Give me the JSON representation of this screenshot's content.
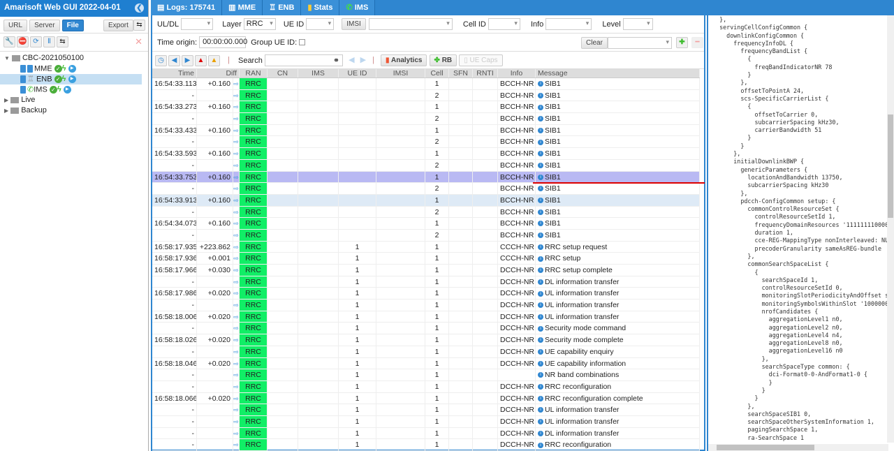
{
  "app": {
    "title": "Amarisoft Web GUI 2022-04-01"
  },
  "left": {
    "buttons": {
      "url": "URL",
      "server": "Server",
      "file": "File",
      "export": "Export"
    },
    "tree": [
      {
        "label": "CBC-2021050100"
      },
      {
        "label": "MME"
      },
      {
        "label": "ENB",
        "selected": true
      },
      {
        "label": "IMS"
      },
      {
        "label": "Live"
      },
      {
        "label": "Backup"
      }
    ]
  },
  "tabs": [
    {
      "label": "Logs: 175741",
      "icon": "document-icon"
    },
    {
      "label": "MME",
      "icon": "database-icon"
    },
    {
      "label": "ENB",
      "icon": "antenna-icon"
    },
    {
      "label": "Stats",
      "icon": "bar-chart-icon"
    },
    {
      "label": "IMS",
      "icon": "phone-icon"
    }
  ],
  "filters": {
    "uldl_label": "UL/DL",
    "uldl_value": "",
    "layer_label": "Layer",
    "layer_value": "RRC",
    "ueid_label": "UE ID",
    "ueid_value": "",
    "imsi_label": "IMSI",
    "imsi_value": "",
    "cellid_label": "Cell ID",
    "info_label": "Info",
    "level_label": "Level",
    "time_origin_label": "Time origin:",
    "time_origin_value": "00:00:00.000",
    "group_ueid_label": "Group UE ID:",
    "clear_label": "Clear",
    "search_label": "Search",
    "analytics_label": "Analytics",
    "rb_label": "RB",
    "uecaps_label": "UE Caps"
  },
  "table": {
    "headers": [
      "Time",
      "Diff",
      "RAN",
      "CN",
      "IMS",
      "UE ID",
      "IMSI",
      "Cell",
      "SFN",
      "RNTI",
      "Info",
      "Message"
    ],
    "rows": [
      [
        "16:54:33.113",
        "+0.160",
        "RRC",
        "",
        "",
        "",
        "",
        "1",
        "",
        "",
        "BCCH-NR",
        "SIB1"
      ],
      [
        "-",
        "",
        "RRC",
        "",
        "",
        "",
        "",
        "2",
        "",
        "",
        "BCCH-NR",
        "SIB1"
      ],
      [
        "16:54:33.273",
        "+0.160",
        "RRC",
        "",
        "",
        "",
        "",
        "1",
        "",
        "",
        "BCCH-NR",
        "SIB1"
      ],
      [
        "-",
        "",
        "RRC",
        "",
        "",
        "",
        "",
        "2",
        "",
        "",
        "BCCH-NR",
        "SIB1"
      ],
      [
        "16:54:33.433",
        "+0.160",
        "RRC",
        "",
        "",
        "",
        "",
        "1",
        "",
        "",
        "BCCH-NR",
        "SIB1"
      ],
      [
        "-",
        "",
        "RRC",
        "",
        "",
        "",
        "",
        "2",
        "",
        "",
        "BCCH-NR",
        "SIB1"
      ],
      [
        "16:54:33.593",
        "+0.160",
        "RRC",
        "",
        "",
        "",
        "",
        "1",
        "",
        "",
        "BCCH-NR",
        "SIB1"
      ],
      [
        "-",
        "",
        "RRC",
        "",
        "",
        "",
        "",
        "2",
        "",
        "",
        "BCCH-NR",
        "SIB1"
      ],
      [
        "16:54:33.753",
        "+0.160",
        "RRC",
        "",
        "",
        "",
        "",
        "1",
        "",
        "",
        "BCCH-NR",
        "SIB1"
      ],
      [
        "-",
        "",
        "RRC",
        "",
        "",
        "",
        "",
        "2",
        "",
        "",
        "BCCH-NR",
        "SIB1"
      ],
      [
        "16:54:33.913",
        "+0.160",
        "RRC",
        "",
        "",
        "",
        "",
        "1",
        "",
        "",
        "BCCH-NR",
        "SIB1"
      ],
      [
        "-",
        "",
        "RRC",
        "",
        "",
        "",
        "",
        "2",
        "",
        "",
        "BCCH-NR",
        "SIB1"
      ],
      [
        "16:54:34.073",
        "+0.160",
        "RRC",
        "",
        "",
        "",
        "",
        "1",
        "",
        "",
        "BCCH-NR",
        "SIB1"
      ],
      [
        "-",
        "",
        "RRC",
        "",
        "",
        "",
        "",
        "2",
        "",
        "",
        "BCCH-NR",
        "SIB1"
      ],
      [
        "16:58:17.935",
        "+223.862",
        "RRC",
        "",
        "",
        "1",
        "",
        "1",
        "",
        "",
        "CCCH-NR",
        "RRC setup request"
      ],
      [
        "16:58:17.936",
        "+0.001",
        "RRC",
        "",
        "",
        "1",
        "",
        "1",
        "",
        "",
        "CCCH-NR",
        "RRC setup"
      ],
      [
        "16:58:17.966",
        "+0.030",
        "RRC",
        "",
        "",
        "1",
        "",
        "1",
        "",
        "",
        "DCCH-NR",
        "RRC setup complete"
      ],
      [
        "-",
        "",
        "RRC",
        "",
        "",
        "1",
        "",
        "1",
        "",
        "",
        "DCCH-NR",
        "DL information transfer"
      ],
      [
        "16:58:17.986",
        "+0.020",
        "RRC",
        "",
        "",
        "1",
        "",
        "1",
        "",
        "",
        "DCCH-NR",
        "UL information transfer"
      ],
      [
        "-",
        "",
        "RRC",
        "",
        "",
        "1",
        "",
        "1",
        "",
        "",
        "DCCH-NR",
        "UL information transfer"
      ],
      [
        "16:58:18.006",
        "+0.020",
        "RRC",
        "",
        "",
        "1",
        "",
        "1",
        "",
        "",
        "DCCH-NR",
        "UL information transfer"
      ],
      [
        "-",
        "",
        "RRC",
        "",
        "",
        "1",
        "",
        "1",
        "",
        "",
        "DCCH-NR",
        "Security mode command"
      ],
      [
        "16:58:18.026",
        "+0.020",
        "RRC",
        "",
        "",
        "1",
        "",
        "1",
        "",
        "",
        "DCCH-NR",
        "Security mode complete"
      ],
      [
        "-",
        "",
        "RRC",
        "",
        "",
        "1",
        "",
        "1",
        "",
        "",
        "DCCH-NR",
        "UE capability enquiry"
      ],
      [
        "16:58:18.046",
        "+0.020",
        "RRC",
        "",
        "",
        "1",
        "",
        "1",
        "",
        "",
        "DCCH-NR",
        "UE capability information"
      ],
      [
        "-",
        "",
        "RRC",
        "",
        "",
        "1",
        "",
        "1",
        "",
        "",
        "",
        "NR band combinations"
      ],
      [
        "-",
        "",
        "RRC",
        "",
        "",
        "1",
        "",
        "1",
        "",
        "",
        "DCCH-NR",
        "RRC reconfiguration"
      ],
      [
        "16:58:18.066",
        "+0.020",
        "RRC",
        "",
        "",
        "1",
        "",
        "1",
        "",
        "",
        "DCCH-NR",
        "RRC reconfiguration complete"
      ],
      [
        "-",
        "",
        "RRC",
        "",
        "",
        "1",
        "",
        "1",
        "",
        "",
        "DCCH-NR",
        "UL information transfer"
      ],
      [
        "-",
        "",
        "RRC",
        "",
        "",
        "1",
        "",
        "1",
        "",
        "",
        "DCCH-NR",
        "UL information transfer"
      ],
      [
        "-",
        "",
        "RRC",
        "",
        "",
        "1",
        "",
        "1",
        "",
        "",
        "DCCH-NR",
        "DL information transfer"
      ],
      [
        "-",
        "",
        "RRC",
        "",
        "",
        "1",
        "",
        "1",
        "",
        "",
        "DCCH-NR",
        "RRC reconfiguration"
      ]
    ],
    "selected_row": 8,
    "hover_row": 10
  },
  "colors": {
    "accent": "#2f86d0",
    "ran_cell": "#11ee66",
    "selected_row": "#b9b9f3"
  },
  "detail": {
    "lines": [
      "  },",
      "  servingCellConfigCommon {",
      "    downlinkConfigCommon {",
      "      frequencyInfoDL {",
      "        frequencyBandList {",
      "          {",
      "            freqBandIndicatorNR 78",
      "          }",
      "        },",
      "        offsetToPointA 24,",
      "        scs-SpecificCarrierList {",
      "          {",
      "            offsetToCarrier 0,",
      "            subcarrierSpacing kHz30,",
      "            carrierBandwidth 51",
      "          }",
      "        }",
      "      },",
      "      initialDownlinkBWP {",
      "        genericParameters {",
      "          locationAndBandwidth 13750,",
      "          subcarrierSpacing kHz30",
      "        },",
      "        pdcch-ConfigCommon setup: {",
      "          commonControlResourceSet {",
      "            controlResourceSetId 1,",
      "            frequencyDomainResources '111111110000",
      "            duration 1,",
      "            cce-REG-MappingType nonInterleaved: NU",
      "            precoderGranularity sameAsREG-bundle",
      "          },",
      "          commonSearchSpaceList {",
      "            {",
      "              searchSpaceId 1,",
      "              controlResourceSetId 0,",
      "              monitoringSlotPeriodicityAndOffset s",
      "              monitoringSymbolsWithinSlot '1000000",
      "              nrofCandidates {",
      "                aggregationLevel1 n0,",
      "                aggregationLevel2 n0,",
      "                aggregationLevel4 n4,",
      "                aggregationLevel8 n0,",
      "                aggregationLevel16 n0",
      "              },",
      "              searchSpaceType common: {",
      "                dci-Format0-0-AndFormat1-0 {",
      "                }",
      "              }",
      "            }",
      "          },",
      "          searchSpaceSIB1 0,",
      "          searchSpaceOtherSystemInformation 1,",
      "          pagingSearchSpace 1,",
      "          ra-SearchSpace 1"
    ]
  }
}
